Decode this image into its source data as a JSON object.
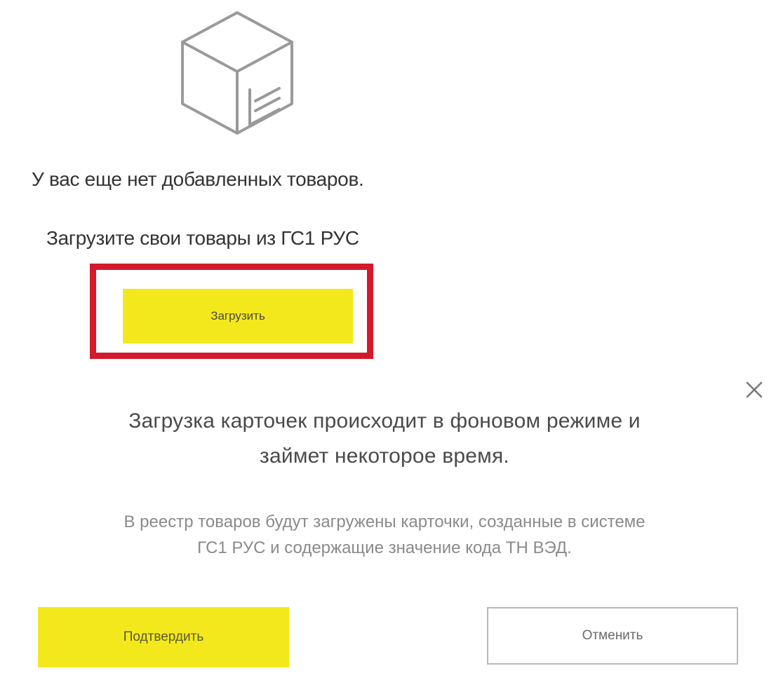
{
  "empty_state": {
    "icon": "box-icon",
    "title": "У вас еще нет добавленных товаров.",
    "subtitle": "Загрузите свои товары из ГС1 РУС",
    "load_button_label": "Загрузить",
    "highlight_color": "#d3192b"
  },
  "modal": {
    "close_icon": "close-icon",
    "heading_line1": "Загрузка карточек происходит в фоновом режиме и",
    "heading_line2": "займет некоторое время.",
    "description_line1": "В реестр товаров будут загружены карточки, созданные в системе",
    "description_line2": "ГС1 РУС и содержащие значение кода ТН ВЭД.",
    "confirm_label": "Подтвердить",
    "cancel_label": "Отменить"
  },
  "colors": {
    "accent_yellow": "#f3e81c",
    "highlight_red": "#d3192b"
  }
}
